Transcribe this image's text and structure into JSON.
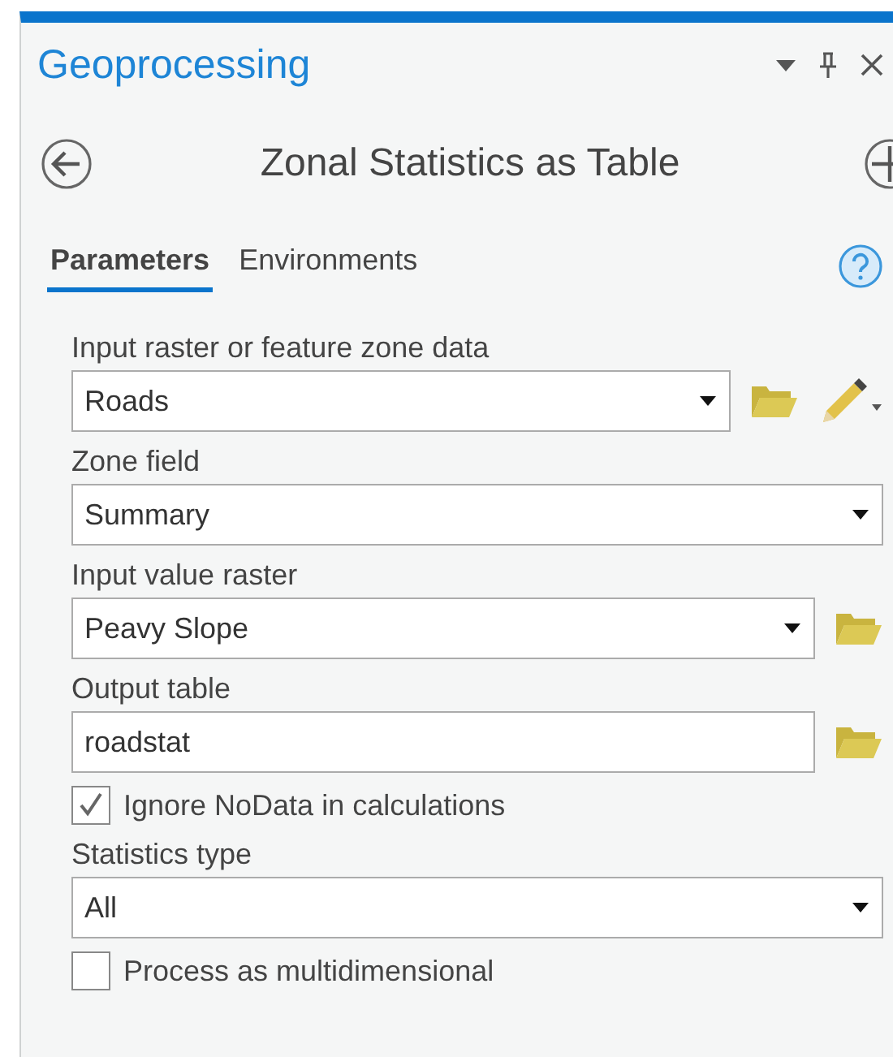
{
  "pane": {
    "title": "Geoprocessing"
  },
  "tool": {
    "title": "Zonal Statistics as Table"
  },
  "tabs": [
    {
      "label": "Parameters",
      "selected": true
    },
    {
      "label": "Environments",
      "selected": false
    }
  ],
  "parameters": [
    {
      "kind": "dropdown",
      "label": "Input raster or feature zone data",
      "value": "Roads",
      "actions": [
        {
          "kind": "folder"
        },
        {
          "kind": "pencil"
        }
      ]
    },
    {
      "kind": "dropdown",
      "label": "Zone field",
      "value": "Summary"
    },
    {
      "kind": "dropdown",
      "label": "Input value raster",
      "value": "Peavy Slope",
      "actions": [
        {
          "kind": "folder"
        }
      ]
    },
    {
      "kind": "text",
      "label": "Output table",
      "value": "roadstat",
      "actions": [
        {
          "kind": "folder"
        }
      ]
    },
    {
      "kind": "checkbox",
      "label": "Ignore NoData in calculations",
      "checked": true
    },
    {
      "kind": "dropdown",
      "label": "Statistics type",
      "value": "All"
    },
    {
      "kind": "checkbox",
      "label": "Process as multidimensional",
      "checked": false
    }
  ]
}
